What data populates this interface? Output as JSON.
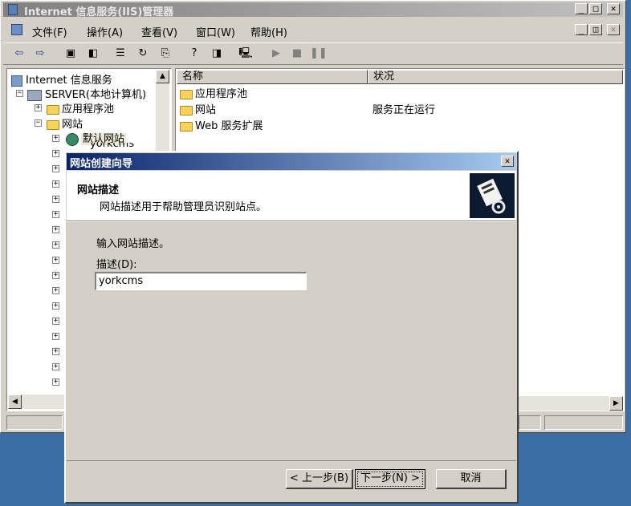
{
  "window": {
    "title": "Internet 信息服务(IIS)管理器"
  },
  "menu": [
    "文件(F)",
    "操作(A)",
    "查看(V)",
    "窗口(W)",
    "帮助(H)"
  ],
  "tree": {
    "root": "Internet 信息服务",
    "server": "SERVER(本地计算机)",
    "app_pools": "应用程序池",
    "websites": "网站",
    "default_site": "默认网站",
    "partial_hidden": "yorkcms"
  },
  "list": {
    "columns": [
      "名称",
      "状况"
    ],
    "rows": [
      {
        "name": "应用程序池",
        "status": ""
      },
      {
        "name": "网站",
        "status": "服务正在运行"
      },
      {
        "name": "Web 服务扩展",
        "status": ""
      }
    ]
  },
  "wizard": {
    "title": "网站创建向导",
    "header_title": "网站描述",
    "header_subtitle": "网站描述用于帮助管理员识别站点。",
    "instruction": "输入网站描述。",
    "field_label": "描述(D):",
    "field_value": "yorkcms",
    "back_label": "< 上一步(B)",
    "next_label": "下一步(N) >",
    "cancel_label": "取消"
  }
}
